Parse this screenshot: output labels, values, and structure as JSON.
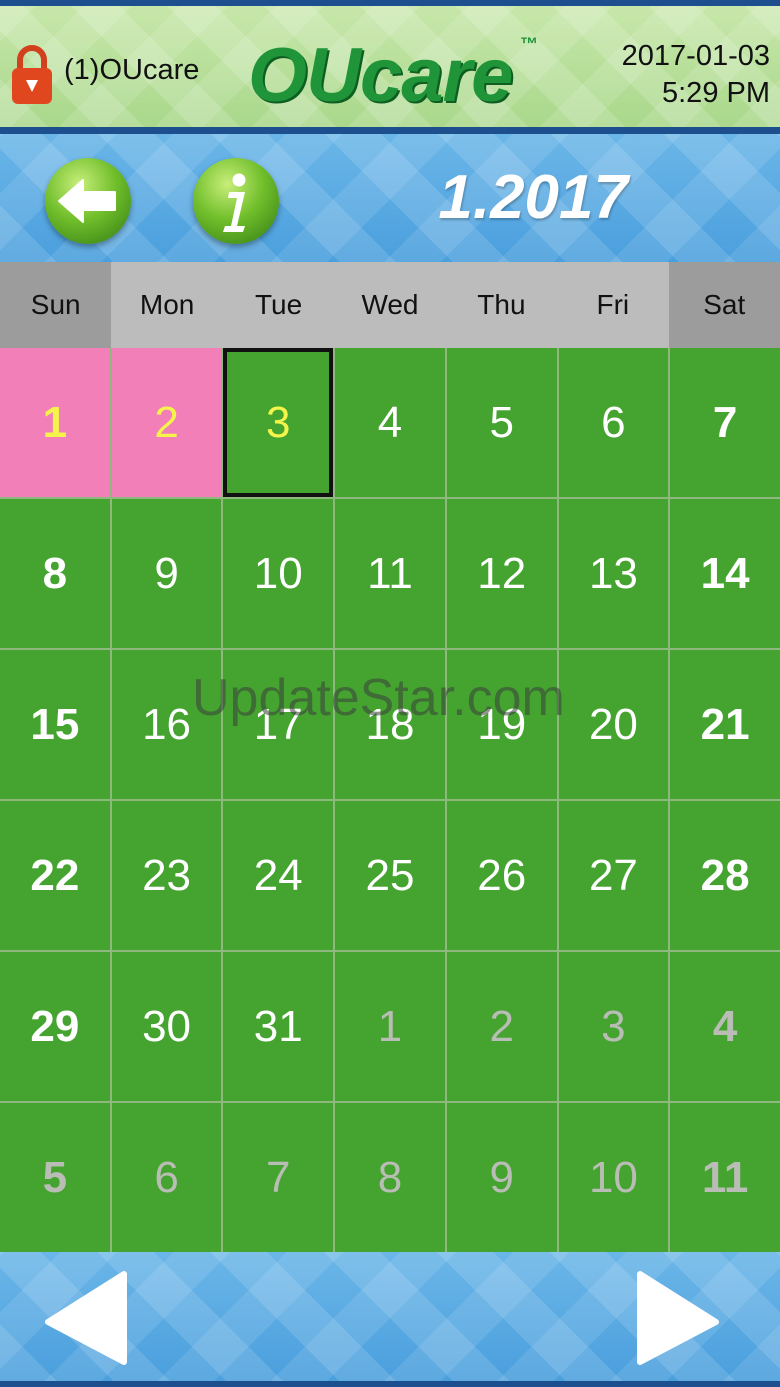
{
  "header": {
    "user_label": "(1)OUcare",
    "logo_text": "OUcare",
    "logo_tm": "™",
    "date": "2017-01-03",
    "time": "5:29 PM",
    "icons": {
      "lock": "lock-icon"
    }
  },
  "navbar": {
    "back_icon": "arrow-left-icon",
    "info_icon": "info-icon",
    "month_label": "1.2017"
  },
  "weekdays": [
    "Sun",
    "Mon",
    "Tue",
    "Wed",
    "Thu",
    "Fri",
    "Sat"
  ],
  "calendar": {
    "weeks": [
      [
        {
          "d": "1",
          "current": true,
          "marked": true
        },
        {
          "d": "2",
          "current": true,
          "marked": true
        },
        {
          "d": "3",
          "current": true,
          "today": true
        },
        {
          "d": "4",
          "current": true
        },
        {
          "d": "5",
          "current": true
        },
        {
          "d": "6",
          "current": true
        },
        {
          "d": "7",
          "current": true
        }
      ],
      [
        {
          "d": "8",
          "current": true
        },
        {
          "d": "9",
          "current": true
        },
        {
          "d": "10",
          "current": true
        },
        {
          "d": "11",
          "current": true
        },
        {
          "d": "12",
          "current": true
        },
        {
          "d": "13",
          "current": true
        },
        {
          "d": "14",
          "current": true
        }
      ],
      [
        {
          "d": "15",
          "current": true
        },
        {
          "d": "16",
          "current": true
        },
        {
          "d": "17",
          "current": true
        },
        {
          "d": "18",
          "current": true
        },
        {
          "d": "19",
          "current": true
        },
        {
          "d": "20",
          "current": true
        },
        {
          "d": "21",
          "current": true
        }
      ],
      [
        {
          "d": "22",
          "current": true
        },
        {
          "d": "23",
          "current": true
        },
        {
          "d": "24",
          "current": true
        },
        {
          "d": "25",
          "current": true
        },
        {
          "d": "26",
          "current": true
        },
        {
          "d": "27",
          "current": true
        },
        {
          "d": "28",
          "current": true
        }
      ],
      [
        {
          "d": "29",
          "current": true
        },
        {
          "d": "30",
          "current": true
        },
        {
          "d": "31",
          "current": true
        },
        {
          "d": "1",
          "current": false
        },
        {
          "d": "2",
          "current": false
        },
        {
          "d": "3",
          "current": false
        },
        {
          "d": "4",
          "current": false
        }
      ],
      [
        {
          "d": "5",
          "current": false
        },
        {
          "d": "6",
          "current": false
        },
        {
          "d": "7",
          "current": false
        },
        {
          "d": "8",
          "current": false
        },
        {
          "d": "9",
          "current": false
        },
        {
          "d": "10",
          "current": false
        },
        {
          "d": "11",
          "current": false
        }
      ]
    ]
  },
  "footer": {
    "prev_icon": "triangle-left-icon",
    "next_icon": "triangle-right-icon"
  },
  "watermark": "UpdateStar.com",
  "colors": {
    "day_green": "#44a42f",
    "marked_pink": "#f37fb8",
    "highlight_yellow": "#f4f44a",
    "header_green": "#1f9438",
    "nav_blue": "#4a9fdd"
  }
}
